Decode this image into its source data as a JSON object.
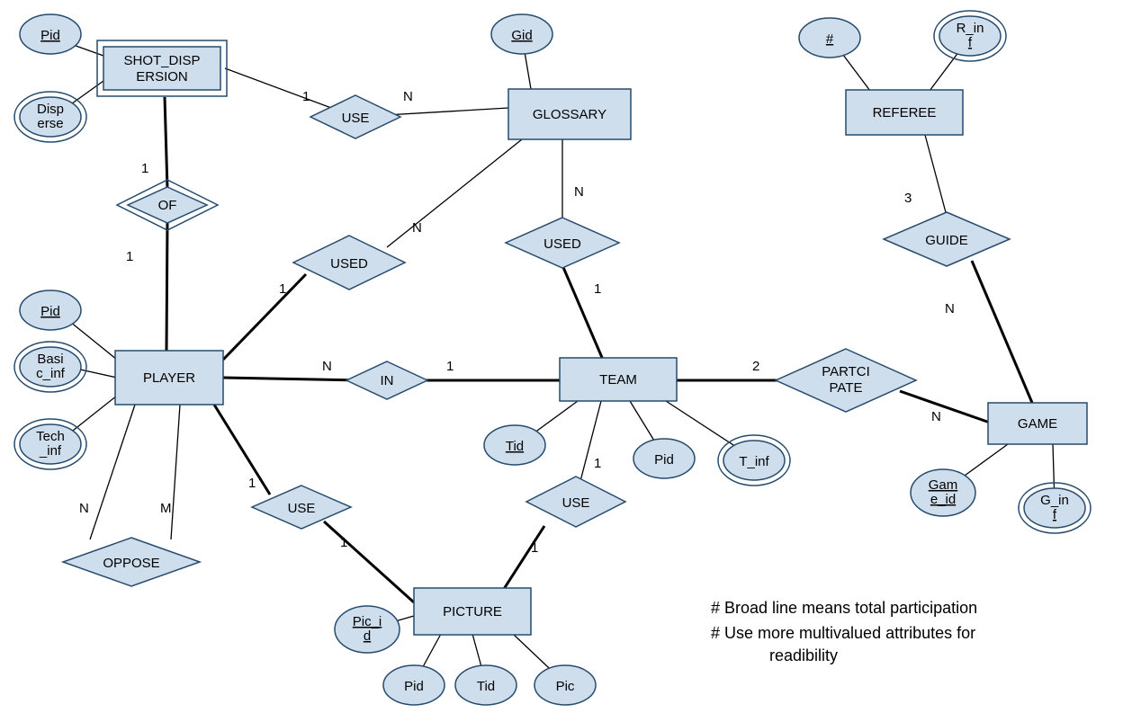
{
  "entities": {
    "shot_dispersion": "SHOT_DISP\nERSION",
    "glossary": "GLOSSARY",
    "referee": "REFEREE",
    "player": "PLAYER",
    "team": "TEAM",
    "game": "GAME",
    "picture": "PICTURE"
  },
  "relationships": {
    "use_sd_gloss": "USE",
    "of": "OF",
    "used_player_gloss": "USED",
    "used_team_gloss": "USED",
    "in_player_team": "IN",
    "guide": "GUIDE",
    "participate": "PARTCI\nPATE",
    "oppose": "OPPOSE",
    "use_player_pic": "USE",
    "use_team_pic": "USE"
  },
  "attributes": {
    "sd_pid": "Pid",
    "sd_disperse": "Disp\nerse",
    "gloss_gid": "Gid",
    "ref_num": "#",
    "ref_rinf": "R_in\nf",
    "player_pid": "Pid",
    "player_basic": "Basi\nc_inf",
    "player_tech": "Tech\n_inf",
    "team_tid": "Tid",
    "team_pid": "Pid",
    "team_tinf": "T_inf",
    "game_id": "Gam\ne_id",
    "game_ginf": "G_in\nf",
    "pic_id": "Pic_i\nd",
    "pic_pid": "Pid",
    "pic_tid": "Tid",
    "pic_pic": "Pic"
  },
  "cardinalities": {
    "sd_use_1": "1",
    "use_gloss_n": "N",
    "of_sd_1": "1",
    "of_player_1": "1",
    "player_used_1": "1",
    "used_gloss_n": "N",
    "team_used_1": "1",
    "used_gloss_n2": "N",
    "player_in_n": "N",
    "in_team_1": "1",
    "team_part_2": "2",
    "part_game_n": "N",
    "ref_guide_3": "3",
    "guide_game_n": "N",
    "oppose_n": "N",
    "oppose_m": "M",
    "player_usepic_1": "1",
    "usepic_pic_1": "1",
    "team_usepic_1": "1",
    "usepic_pic_1b": "1"
  },
  "notes": {
    "line1": "# Broad line means  total participation",
    "line2": "# Use more multivalued attributes for",
    "line3": "readibility"
  }
}
